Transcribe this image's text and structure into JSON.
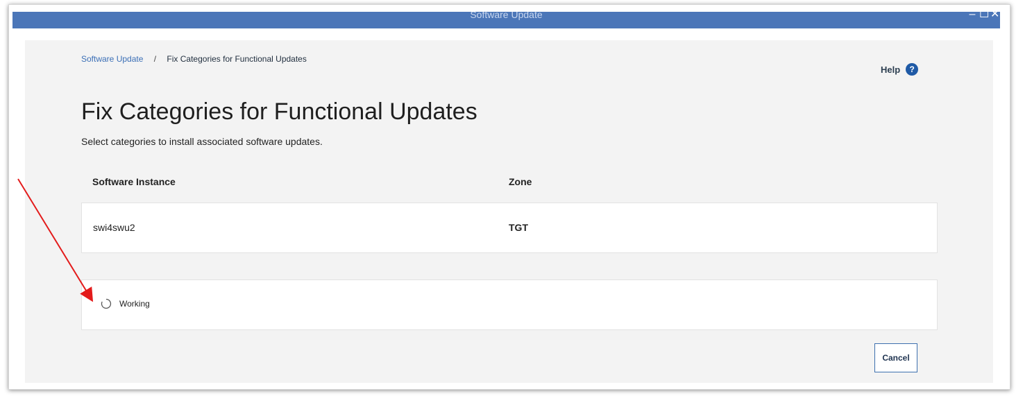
{
  "window": {
    "title": "Software Update",
    "controls": {
      "minimize_glyph": "–",
      "maximize_glyph": "☐",
      "close_glyph": "✕"
    }
  },
  "breadcrumb": {
    "root_label": "Software Update",
    "separator": "/",
    "current_label": "Fix Categories for Functional Updates"
  },
  "help": {
    "label": "Help",
    "icon": "help-circle-icon",
    "icon_glyph": "?"
  },
  "page": {
    "title": "Fix Categories for Functional Updates",
    "subtitle": "Select categories to install associated software updates."
  },
  "table": {
    "columns": [
      "Software Instance",
      "Zone"
    ],
    "rows": [
      {
        "software_instance": "swi4swu2",
        "zone": "TGT"
      }
    ]
  },
  "status": {
    "icon": "spinner-icon",
    "text": "Working"
  },
  "actions": {
    "cancel_label": "Cancel"
  },
  "colors": {
    "titlebar": "#4b76b8",
    "panel_background": "#f3f3f3",
    "link": "#3b6fb6",
    "help_icon": "#1f5aa6",
    "annotation_arrow": "#e31b1b"
  }
}
